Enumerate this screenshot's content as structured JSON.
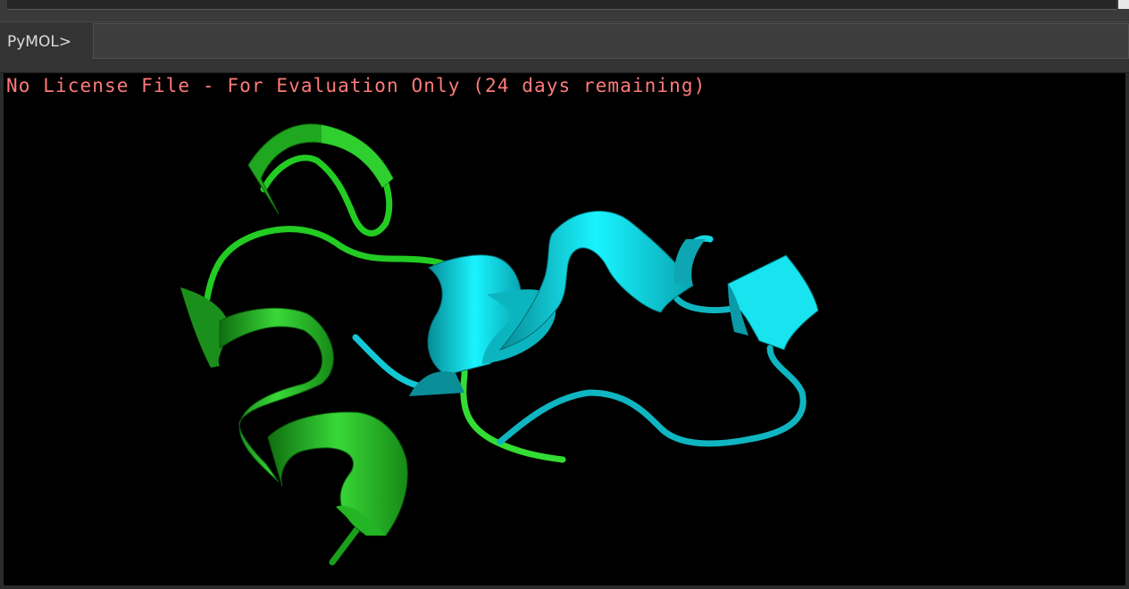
{
  "command": {
    "prompt": "PyMOL>",
    "input_value": ""
  },
  "viewer": {
    "license_message": "No License File - For Evaluation Only (24 days remaining)",
    "background_color": "#000000",
    "chains": [
      {
        "color": "#22cc22",
        "shade": "#138a13"
      },
      {
        "color": "#00e0e8",
        "shade": "#0a9aa8"
      }
    ]
  },
  "colors": {
    "message_text": "#ff7a7a",
    "panel": "#333333"
  }
}
